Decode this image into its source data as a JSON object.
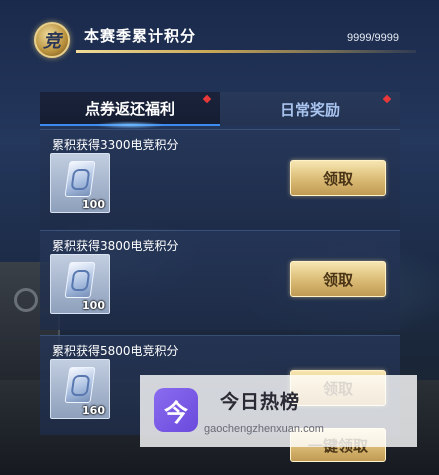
{
  "header": {
    "badge_char": "竞",
    "title": "本赛季累计积分",
    "count": "9999/9999"
  },
  "tabs": [
    {
      "label": "点券返还福利",
      "active": true
    },
    {
      "label": "日常奖励",
      "active": false
    }
  ],
  "rewards": [
    {
      "label": "累积获得3300电竞积分",
      "quantity": "100",
      "button": "领取"
    },
    {
      "label": "累积获得3800电竞积分",
      "quantity": "100",
      "button": "领取"
    },
    {
      "label": "累积获得5800电竞积分",
      "quantity": "160",
      "button": "领取"
    }
  ],
  "one_click_button": "一键领取",
  "watermark": {
    "logo_char": "今",
    "title": "今日热榜",
    "url": "gaochengzhenxuan.com"
  },
  "colors": {
    "accent_gold": "#dcbe78",
    "tab_underline": "#3c8cf0",
    "notification_dot": "#e83838",
    "watermark_purple": "#7a5ce6"
  }
}
